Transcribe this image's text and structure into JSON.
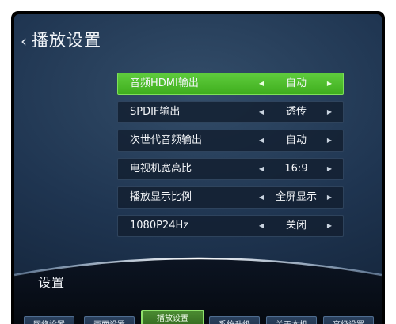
{
  "header": {
    "title": "播放设置"
  },
  "settings": [
    {
      "label": "音频HDMI输出",
      "value": "自动"
    },
    {
      "label": "SPDIF输出",
      "value": "透传"
    },
    {
      "label": "次世代音频输出",
      "value": "自动"
    },
    {
      "label": "电视机宽高比",
      "value": "16:9"
    },
    {
      "label": "播放显示比例",
      "value": "全屏显示"
    },
    {
      "label": "1080P24Hz",
      "value": "关闭"
    }
  ],
  "footer": {
    "section_label": "设置",
    "tabs": [
      {
        "label": "网络设置"
      },
      {
        "label": "画面设置"
      },
      {
        "label": "播放设置"
      },
      {
        "label": "系统升级"
      },
      {
        "label": "关于本机"
      },
      {
        "label": "高级设置"
      }
    ]
  },
  "colors": {
    "highlight": "#4fbd2c",
    "background": "#1f3551"
  },
  "icons": {
    "back": "chevron-left-icon",
    "arrow_left": "arrow-left-icon",
    "arrow_right": "arrow-right-icon"
  }
}
